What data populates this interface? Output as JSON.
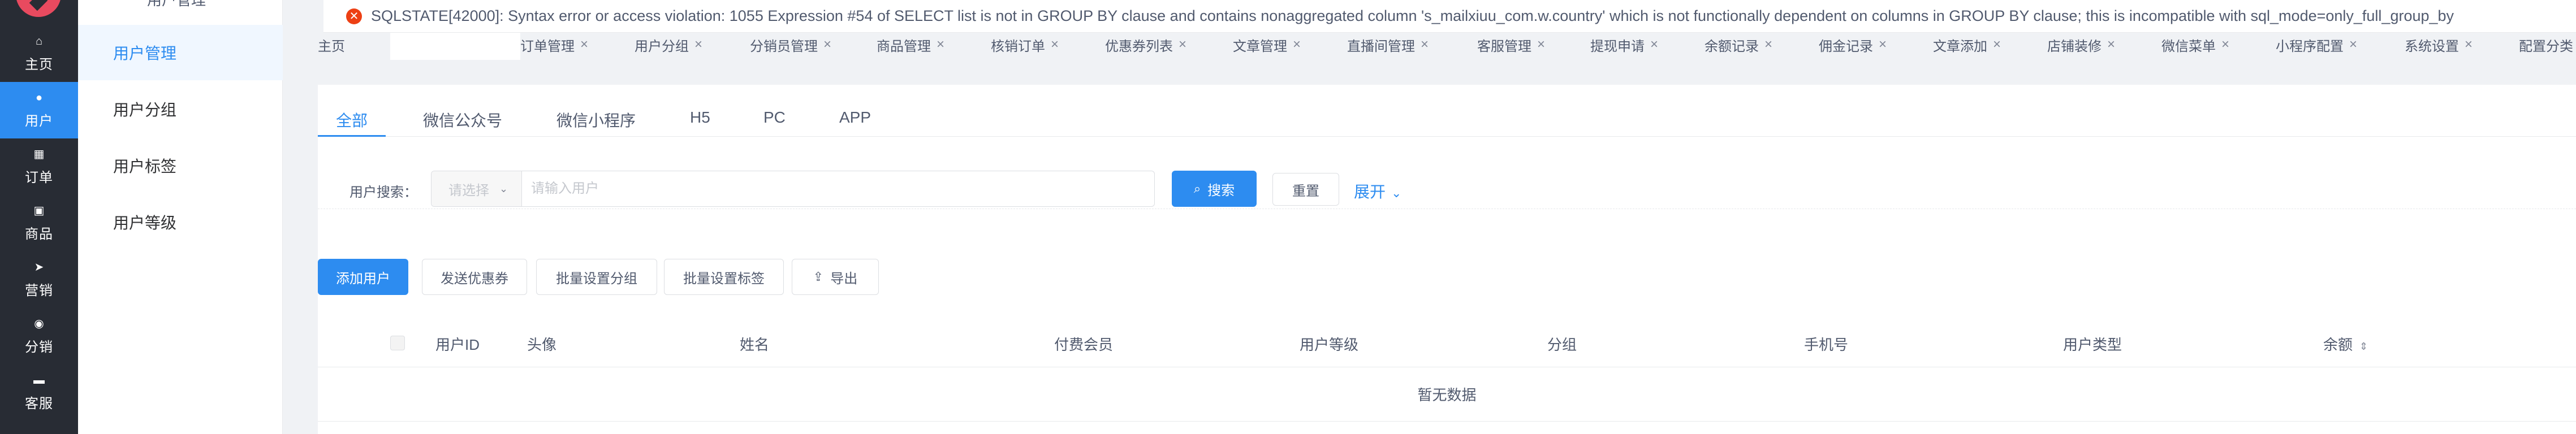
{
  "sidebar": {
    "items": [
      {
        "label": "主页",
        "icon": "home-icon",
        "glyph": "⌂"
      },
      {
        "label": "用户",
        "icon": "user-icon",
        "glyph": "●"
      },
      {
        "label": "订单",
        "icon": "cart-icon",
        "glyph": "▦"
      },
      {
        "label": "商品",
        "icon": "shop-icon",
        "glyph": "▣"
      },
      {
        "label": "营销",
        "icon": "send-icon",
        "glyph": "➤"
      },
      {
        "label": "分销",
        "icon": "group-icon",
        "glyph": "◉"
      },
      {
        "label": "客服",
        "icon": "chat-icon",
        "glyph": "▬"
      }
    ]
  },
  "submenu": {
    "title": "用户管理",
    "items": [
      {
        "label": "用户管理"
      },
      {
        "label": "用户分组"
      },
      {
        "label": "用户标签"
      },
      {
        "label": "用户等级"
      }
    ]
  },
  "error": {
    "message": "SQLSTATE[42000]: Syntax error or access violation: 1055 Expression #54 of SELECT list is not in GROUP BY clause and contains nonaggregated column 's_mailxiuu_com.w.country' which is not functionally dependent on columns in GROUP BY clause; this is incompatible with sql_mode=only_full_group_by"
  },
  "page_tabs": [
    {
      "label": "主页",
      "closable": false
    },
    {
      "label": "",
      "closable": false
    },
    {
      "label": "订单管理",
      "closable": true
    },
    {
      "label": "用户分组",
      "closable": true
    },
    {
      "label": "分销员管理",
      "closable": true
    },
    {
      "label": "商品管理",
      "closable": true
    },
    {
      "label": "核销订单",
      "closable": true
    },
    {
      "label": "优惠券列表",
      "closable": true
    },
    {
      "label": "文章管理",
      "closable": true
    },
    {
      "label": "直播间管理",
      "closable": true
    },
    {
      "label": "客服管理",
      "closable": true
    },
    {
      "label": "提现申请",
      "closable": true
    },
    {
      "label": "余额记录",
      "closable": true
    },
    {
      "label": "佣金记录",
      "closable": true
    },
    {
      "label": "文章添加",
      "closable": true
    },
    {
      "label": "店铺装修",
      "closable": true
    },
    {
      "label": "微信菜单",
      "closable": true
    },
    {
      "label": "小程序配置",
      "closable": true
    },
    {
      "label": "系统设置",
      "closable": true
    },
    {
      "label": "配置分类",
      "closable": false
    }
  ],
  "type_tabs": [
    {
      "label": "全部"
    },
    {
      "label": "微信公众号"
    },
    {
      "label": "微信小程序"
    },
    {
      "label": "H5"
    },
    {
      "label": "PC"
    },
    {
      "label": "APP"
    }
  ],
  "search": {
    "label": "用户搜索：",
    "select_placeholder": "请选择",
    "input_placeholder": "请输入用户",
    "search_button": "搜索",
    "reset_button": "重置",
    "expand_link": "展开"
  },
  "actions": {
    "add_user": "添加用户",
    "send_coupon": "发送优惠券",
    "batch_group": "批量设置分组",
    "batch_tag": "批量设置标签",
    "export": "导出"
  },
  "table": {
    "columns": [
      "用户ID",
      "头像",
      "姓名",
      "付费会员",
      "用户等级",
      "分组",
      "手机号",
      "用户类型",
      "余额"
    ],
    "empty_text": "暂无数据"
  },
  "colors": {
    "accent": "#2d8cf0",
    "sidebar_bg": "#282c34",
    "error": "#ed4014"
  }
}
